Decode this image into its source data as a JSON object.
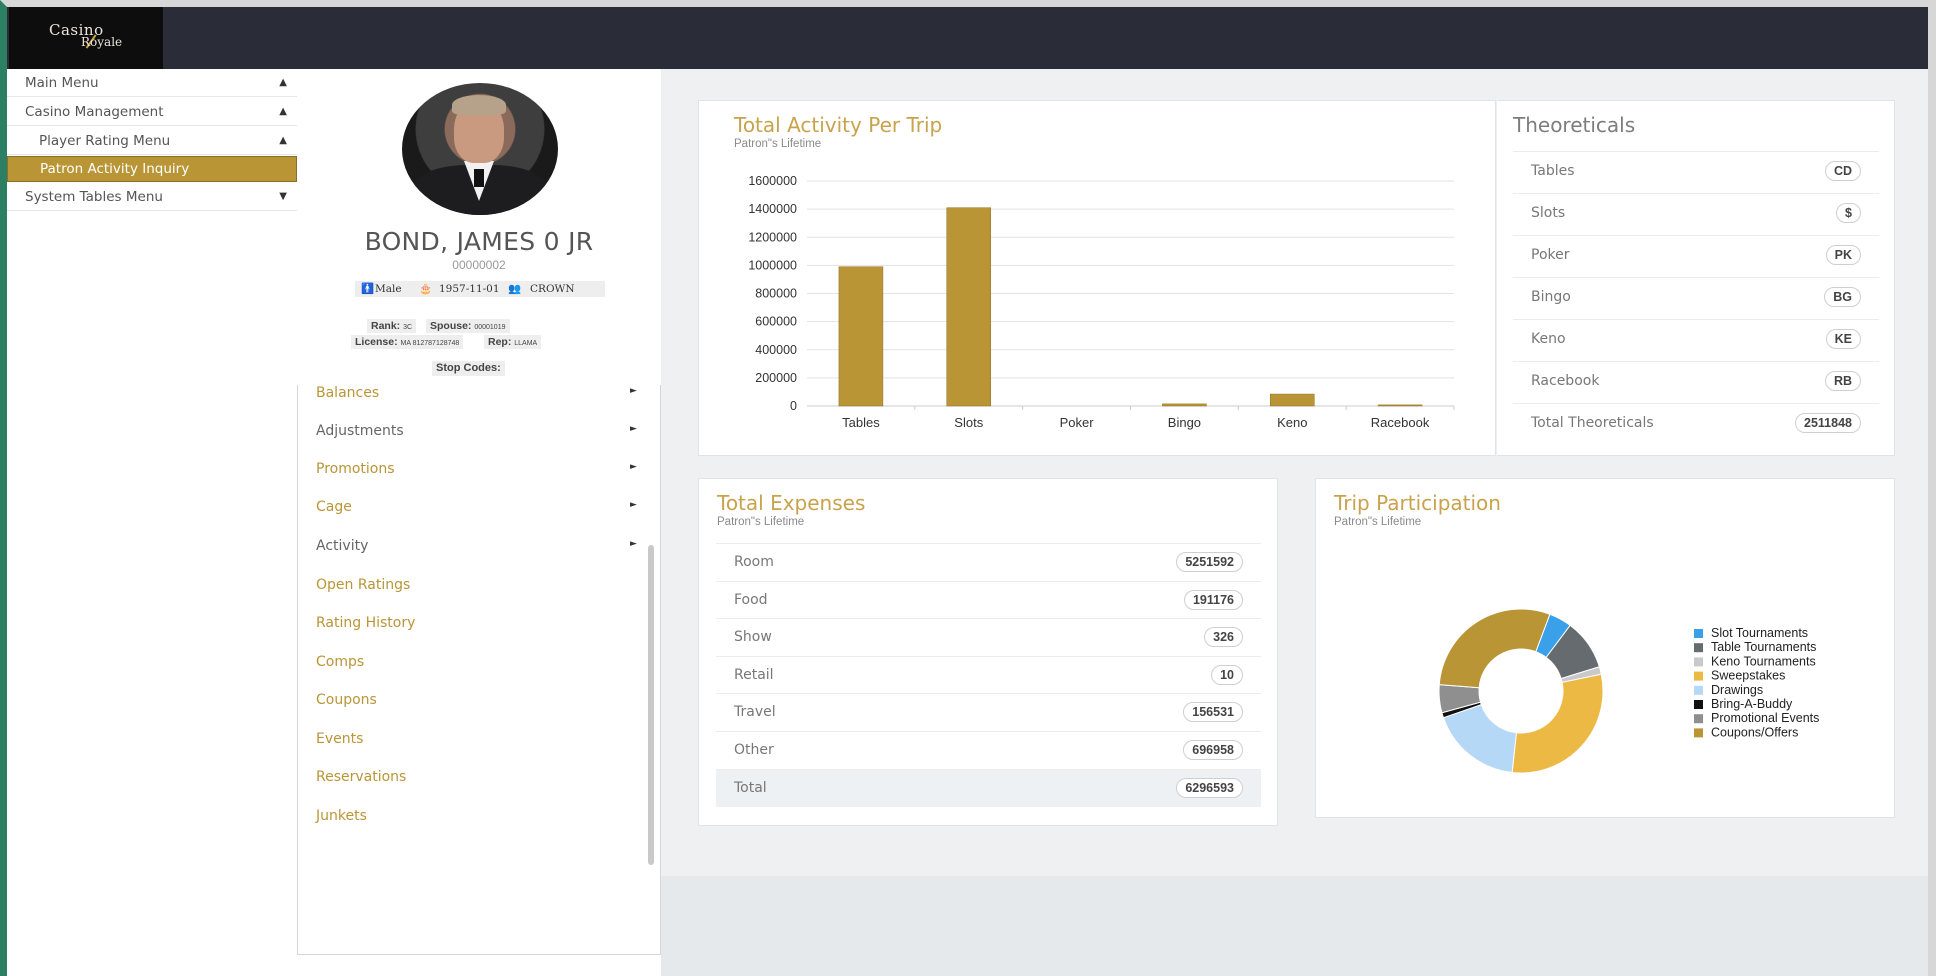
{
  "logo": {
    "line1": "Casino",
    "line2": "Royale"
  },
  "nav": [
    {
      "label": "Main Menu",
      "arrow": "▲"
    },
    {
      "label": "Casino Management",
      "arrow": "▲"
    },
    {
      "label": "Player Rating Menu",
      "arrow": "▲"
    },
    {
      "label": "Patron Activity Inquiry",
      "arrow": ""
    },
    {
      "label": "System Tables Menu",
      "arrow": "▼"
    }
  ],
  "patron": {
    "name": "BOND, JAMES 0 JR",
    "id": "00000002",
    "gender": "Male",
    "dob": "1957-11-01",
    "club": "CROWN",
    "rank_label": "Rank:",
    "rank_value": "3C",
    "spouse_label": "Spouse:",
    "spouse_value": "00001019",
    "license_label": "License:",
    "license_value": "MA 812787128748",
    "rep_label": "Rep:",
    "rep_value": "LLAMA",
    "stop_codes": "Stop Codes:"
  },
  "patron_menu": [
    {
      "label": "Balances",
      "arrow": "►",
      "style": "gold"
    },
    {
      "label": "Adjustments",
      "arrow": "►",
      "style": "grey"
    },
    {
      "label": "Promotions",
      "arrow": "►",
      "style": "gold"
    },
    {
      "label": "Cage",
      "arrow": "►",
      "style": "gold"
    },
    {
      "label": "Activity",
      "arrow": "►",
      "style": "grey"
    },
    {
      "label": "Open Ratings",
      "arrow": "",
      "style": "gold"
    },
    {
      "label": "Rating History",
      "arrow": "",
      "style": "gold"
    },
    {
      "label": "Comps",
      "arrow": "",
      "style": "gold"
    },
    {
      "label": "Coupons",
      "arrow": "",
      "style": "gold"
    },
    {
      "label": "Events",
      "arrow": "",
      "style": "gold"
    },
    {
      "label": "Reservations",
      "arrow": "",
      "style": "gold"
    },
    {
      "label": "Junkets",
      "arrow": "",
      "style": "gold"
    }
  ],
  "activity": {
    "title": "Total Activity Per Trip",
    "subtitle": "Patron\"s Lifetime"
  },
  "theoreticals": {
    "title": "Theoreticals",
    "rows": [
      {
        "label": "Tables",
        "value": "CD"
      },
      {
        "label": "Slots",
        "value": "$"
      },
      {
        "label": "Poker",
        "value": "PK"
      },
      {
        "label": "Bingo",
        "value": "BG"
      },
      {
        "label": "Keno",
        "value": "KE"
      },
      {
        "label": "Racebook",
        "value": "RB"
      },
      {
        "label": "Total Theoreticals",
        "value": "2511848"
      }
    ]
  },
  "expenses": {
    "title": "Total Expenses",
    "subtitle": "Patron\"s Lifetime",
    "rows": [
      {
        "label": "Room",
        "value": "5251592"
      },
      {
        "label": "Food",
        "value": "191176"
      },
      {
        "label": "Show",
        "value": "326"
      },
      {
        "label": "Retail",
        "value": "10"
      },
      {
        "label": "Travel",
        "value": "156531"
      },
      {
        "label": "Other",
        "value": "696958"
      },
      {
        "label": "Total",
        "value": "6296593"
      }
    ]
  },
  "trip": {
    "title": "Trip Participation",
    "subtitle": "Patron\"s Lifetime"
  },
  "chart_data": [
    {
      "type": "bar",
      "title": "Total Activity Per Trip",
      "subtitle": "Patron\"s Lifetime",
      "categories": [
        "Tables",
        "Slots",
        "Poker",
        "Bingo",
        "Keno",
        "Racebook"
      ],
      "values": [
        990000,
        1410000,
        0,
        15000,
        85000,
        8000
      ],
      "yticks": [
        0,
        200000,
        400000,
        600000,
        800000,
        1000000,
        1200000,
        1400000,
        1600000
      ],
      "ylim": [
        0,
        1600000
      ],
      "grid": true,
      "color": "#b99536"
    },
    {
      "type": "pie",
      "title": "Trip Participation",
      "subtitle": "Patron\"s Lifetime",
      "legend_position": "right",
      "labels": [
        "Slot Tournaments",
        "Table Tournaments",
        "Keno Tournaments",
        "Sweepstakes",
        "Drawings",
        "Bring-A-Buddy",
        "Promotional Events",
        "Coupons/Offers"
      ],
      "values": [
        4.5,
        10,
        1.5,
        30,
        18,
        1,
        5.5,
        29.5
      ],
      "colors": [
        "#3aa0ea",
        "#666b70",
        "#c9c9c9",
        "#ecb944",
        "#b5d8f6",
        "#111111",
        "#8f8f8f",
        "#b99536"
      ]
    }
  ]
}
